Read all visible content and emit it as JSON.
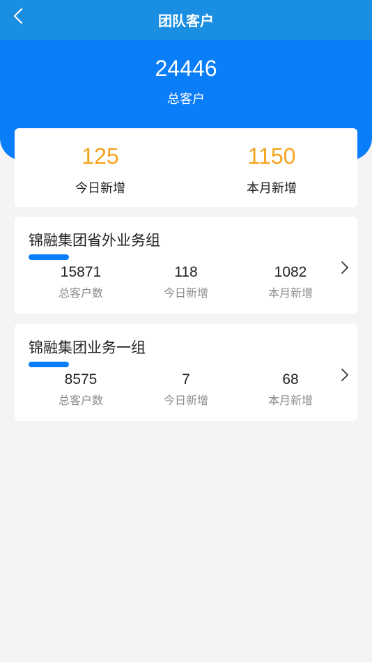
{
  "header": {
    "title": "团队客户",
    "back_icon": "chevron-left-icon"
  },
  "hero": {
    "total": "24446",
    "total_label": "总客户"
  },
  "summary": {
    "today_value": "125",
    "today_label": "今日新增",
    "month_value": "1150",
    "month_label": "本月新增"
  },
  "groups": [
    {
      "name": "锦融集团省外业务组",
      "total": "15871",
      "total_label": "总客户数",
      "today": "118",
      "today_label": "今日新增",
      "month": "1082",
      "month_label": "本月新增"
    },
    {
      "name": "锦融集团业务一组",
      "total": "8575",
      "total_label": "总客户数",
      "today": "7",
      "today_label": "今日新增",
      "month": "68",
      "month_label": "本月新增"
    }
  ],
  "colors": {
    "navbar": "#1a8ee0",
    "hero": "#0a7df8",
    "accent_orange": "#f5a31c",
    "background": "#f4f4f4"
  }
}
